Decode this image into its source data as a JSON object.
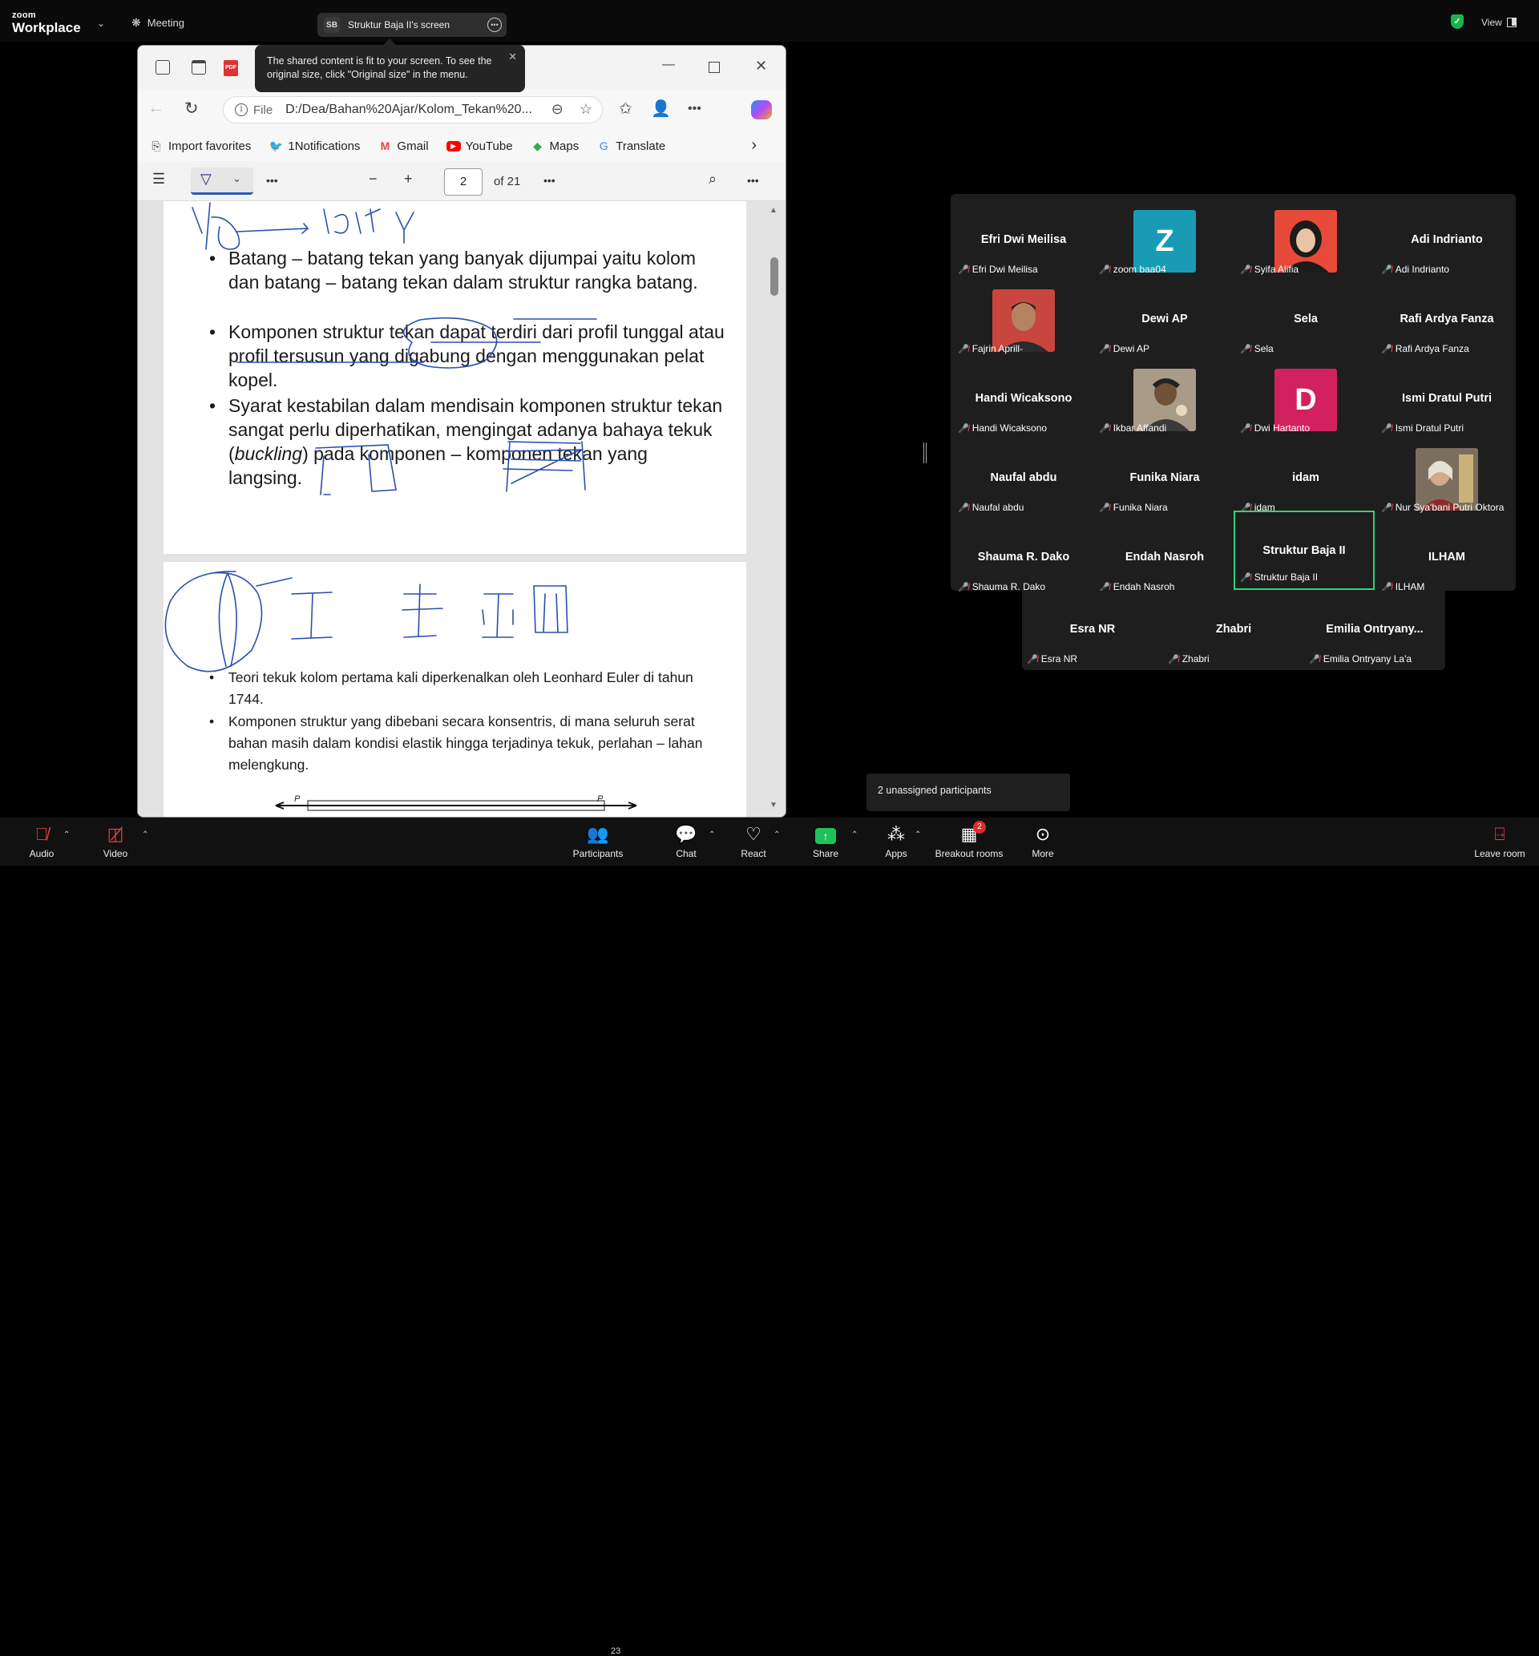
{
  "zoom": {
    "logo_small": "zoom",
    "logo_big": "Workplace",
    "meeting_label": "Meeting",
    "share_badge": "SB",
    "share_label": "Struktur Baja II's screen",
    "view_label": "View"
  },
  "tooltip": {
    "text": "The shared content is fit to your screen. To see the original size, click \"Original size\" in the menu."
  },
  "browser": {
    "url_prefix": "File",
    "url": "D:/Dea/Bahan%20Ajar/Kolom_Tekan%20...",
    "favorites": [
      {
        "label": "Import favorites",
        "icon": "import-icon",
        "color": "#444444"
      },
      {
        "label": "1Notifications",
        "icon": "twitter-icon",
        "color": "#1d9bf0"
      },
      {
        "label": "Gmail",
        "icon": "gmail-icon",
        "color": "#ea4335"
      },
      {
        "label": "YouTube",
        "icon": "youtube-icon",
        "color": "#ff0000"
      },
      {
        "label": "Maps",
        "icon": "maps-icon",
        "color": "#34a853"
      },
      {
        "label": "Translate",
        "icon": "translate-icon",
        "color": "#4285f4"
      }
    ],
    "pdf": {
      "current_page": "2",
      "page_total": "of 21"
    }
  },
  "slide1": {
    "bullets": [
      "Batang – batang tekan yang banyak dijumpai yaitu kolom dan batang – batang tekan dalam struktur rangka batang.",
      "Komponen struktur tekan dapat terdiri dari profil tunggal atau profil tersusun yang digabung dengan menggunakan pelat kopel."
    ],
    "bullet3_pre": "Syarat kestabilan dalam mendisain komponen struktur tekan sangat perlu diperhatikan, mengingat adanya bahaya tekuk (",
    "bullet3_italic": "buckling",
    "bullet3_post": ") pada komponen – komponen tekan yang langsing."
  },
  "slide2": {
    "bullets": [
      "Teori tekuk kolom pertama kali diperkenalkan oleh Leonhard Euler di tahun 1744.",
      "Komponen struktur yang dibebani secara konsentris, di mana seluruh serat bahan masih dalam kondisi elastik hingga terjadinya tekuk, perlahan – lahan melengkung."
    ],
    "load_left": "P",
    "load_right": "P"
  },
  "participants": [
    {
      "name": "Efri Dwi Meilisa",
      "label": "Efri Dwi Meilisa",
      "type": "name"
    },
    {
      "name": "",
      "label": "zoom baa04",
      "type": "letter",
      "letter": "Z",
      "color": "#1a9bb5"
    },
    {
      "name": "",
      "label": "Syifa Alifia",
      "type": "photo",
      "color": "#e84a3a"
    },
    {
      "name": "Adi Indrianto",
      "label": "Adi Indrianto",
      "type": "name"
    },
    {
      "name": "",
      "label": "Fajrin Aprill-",
      "type": "photo",
      "color": "#c8463d"
    },
    {
      "name": "Dewi AP",
      "label": "Dewi AP",
      "type": "name"
    },
    {
      "name": "Sela",
      "label": "Sela",
      "type": "name"
    },
    {
      "name": "Rafi Ardya Fanza",
      "label": "Rafi Ardya Fanza",
      "type": "name"
    },
    {
      "name": "Handi Wicaksono",
      "label": "Handi Wicaksono",
      "type": "name"
    },
    {
      "name": "",
      "label": "Ikbar Affandi",
      "type": "photo",
      "color": "#8a8070"
    },
    {
      "name": "",
      "label": "Dwi Hartanto",
      "type": "letter",
      "letter": "D",
      "color": "#d2215e"
    },
    {
      "name": "Ismi Dratul Putri",
      "label": "Ismi Dratul Putri",
      "type": "name"
    },
    {
      "name": "Naufal abdu",
      "label": "Naufal abdu",
      "type": "name"
    },
    {
      "name": "Funika Niara",
      "label": "Funika Niara",
      "type": "name"
    },
    {
      "name": "idam",
      "label": "idam",
      "type": "name"
    },
    {
      "name": "",
      "label": "Nur Sya'bani Putri Oktora",
      "type": "photo",
      "color": "#6a5a48"
    },
    {
      "name": "Shauma R. Dako",
      "label": "Shauma R. Dako",
      "type": "name"
    },
    {
      "name": "Endah Nasroh",
      "label": "Endah Nasroh",
      "type": "name"
    },
    {
      "name": "Struktur Baja II",
      "label": "Struktur Baja II",
      "type": "name",
      "active": true
    },
    {
      "name": "ILHAM",
      "label": "ILHAM",
      "type": "name"
    }
  ],
  "participants_row2": [
    {
      "name": "Esra NR",
      "label": "Esra NR"
    },
    {
      "name": "Zhabri",
      "label": "Zhabri"
    },
    {
      "name": "Emilia  Ontryany...",
      "label": "Emilia Ontryany La'a"
    }
  ],
  "unassigned": "2 unassigned participants",
  "toolbar": {
    "audio": "Audio",
    "video": "Video",
    "participants": "Participants",
    "participants_count": "23",
    "chat": "Chat",
    "react": "React",
    "share": "Share",
    "apps": "Apps",
    "breakout": "Breakout rooms",
    "breakout_badge": "2",
    "more": "More",
    "leave": "Leave room"
  }
}
